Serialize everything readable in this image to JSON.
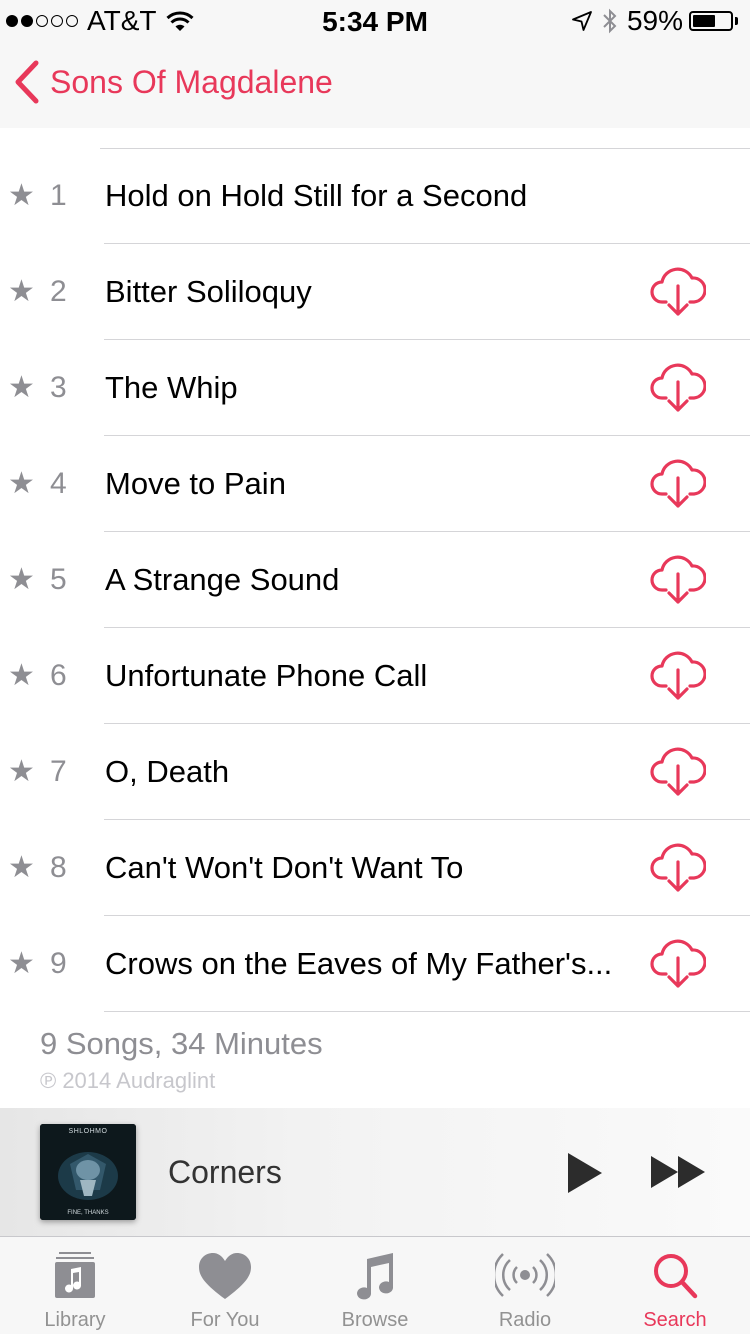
{
  "status_bar": {
    "carrier": "AT&T",
    "signal_dots": 5,
    "signal_filled": 2,
    "time": "5:34 PM",
    "battery": "59%"
  },
  "nav": {
    "back_label": "Sons Of Magdalene"
  },
  "tracks": [
    {
      "number": "1",
      "title": "Hold on Hold Still for a Second",
      "star": "★",
      "downloadable": false
    },
    {
      "number": "2",
      "title": "Bitter Soliloquy",
      "star": "★",
      "downloadable": true
    },
    {
      "number": "3",
      "title": "The Whip",
      "star": "★",
      "downloadable": true
    },
    {
      "number": "4",
      "title": "Move to Pain",
      "star": "★",
      "downloadable": true
    },
    {
      "number": "5",
      "title": "A Strange Sound",
      "star": "★",
      "downloadable": true
    },
    {
      "number": "6",
      "title": "Unfortunate Phone Call",
      "star": "★",
      "downloadable": true
    },
    {
      "number": "7",
      "title": "O, Death",
      "star": "★",
      "downloadable": true
    },
    {
      "number": "8",
      "title": "Can't Won't Don't Want To",
      "star": "★",
      "downloadable": true
    },
    {
      "number": "9",
      "title": "Crows on the Eaves of My Father's...",
      "star": "★",
      "downloadable": true
    }
  ],
  "summary": "9 Songs, 34 Minutes",
  "copyright": "℗ 2014 Audraglint",
  "now_playing": {
    "title": "Corners",
    "artwork_artist": "SHLOHMO",
    "artwork_caption": "FINE, THANKS"
  },
  "tabs": [
    {
      "label": "Library",
      "icon": "library-icon",
      "active": false
    },
    {
      "label": "For You",
      "icon": "heart-icon",
      "active": false
    },
    {
      "label": "Browse",
      "icon": "music-note-icon",
      "active": false
    },
    {
      "label": "Radio",
      "icon": "radio-icon",
      "active": false
    },
    {
      "label": "Search",
      "icon": "search-icon",
      "active": true
    }
  ],
  "colors": {
    "accent": "#e8385a",
    "secondary_text": "#8e8e93",
    "tab_inactive": "#929292"
  }
}
